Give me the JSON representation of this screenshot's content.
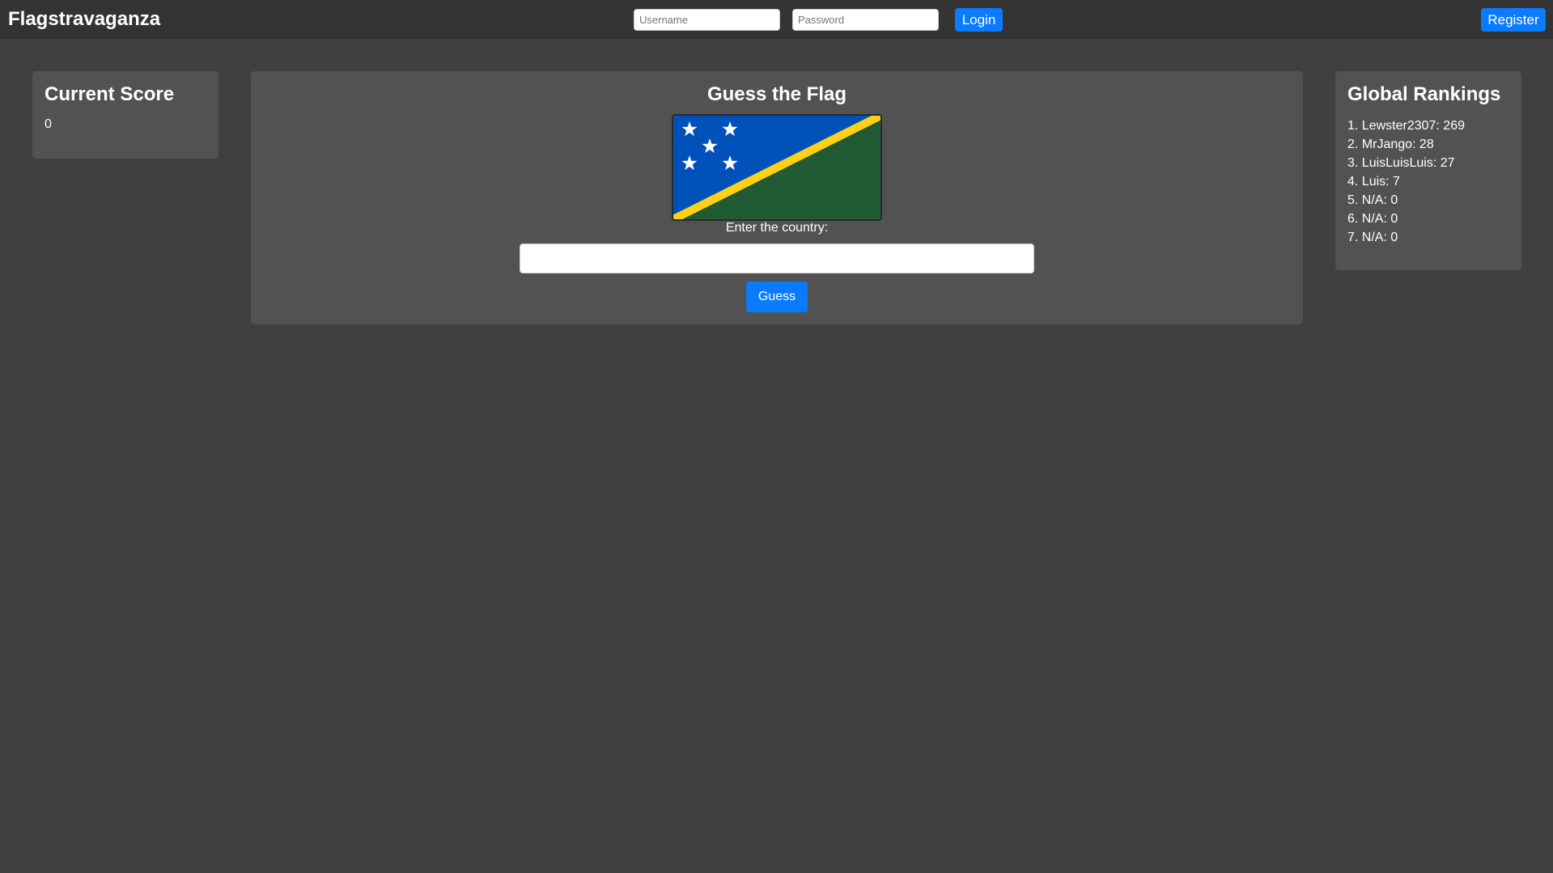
{
  "header": {
    "brand": "Flagstravaganza",
    "username_placeholder": "Username",
    "password_placeholder": "Password",
    "login_label": "Login",
    "register_label": "Register"
  },
  "score": {
    "title": "Current Score",
    "value": "0"
  },
  "game": {
    "title": "Guess the Flag",
    "flag_icon": "solomon-islands-flag-icon",
    "prompt": "Enter the country:",
    "input_value": "",
    "guess_label": "Guess"
  },
  "rankings": {
    "title": "Global Rankings",
    "items": [
      "1. Lewster2307: 269",
      "2. MrJango: 28",
      "3. LuisLuisLuis: 27",
      "4. Luis: 7",
      "5. N/A: 0",
      "6. N/A: 0",
      "7. N/A: 0"
    ]
  },
  "colors": {
    "background": "#404040",
    "header": "#333333",
    "panel": "#525252",
    "accent": "#0a7bff",
    "flag_blue": "#0051ba",
    "flag_green": "#215b33",
    "flag_yellow": "#fcd116"
  }
}
